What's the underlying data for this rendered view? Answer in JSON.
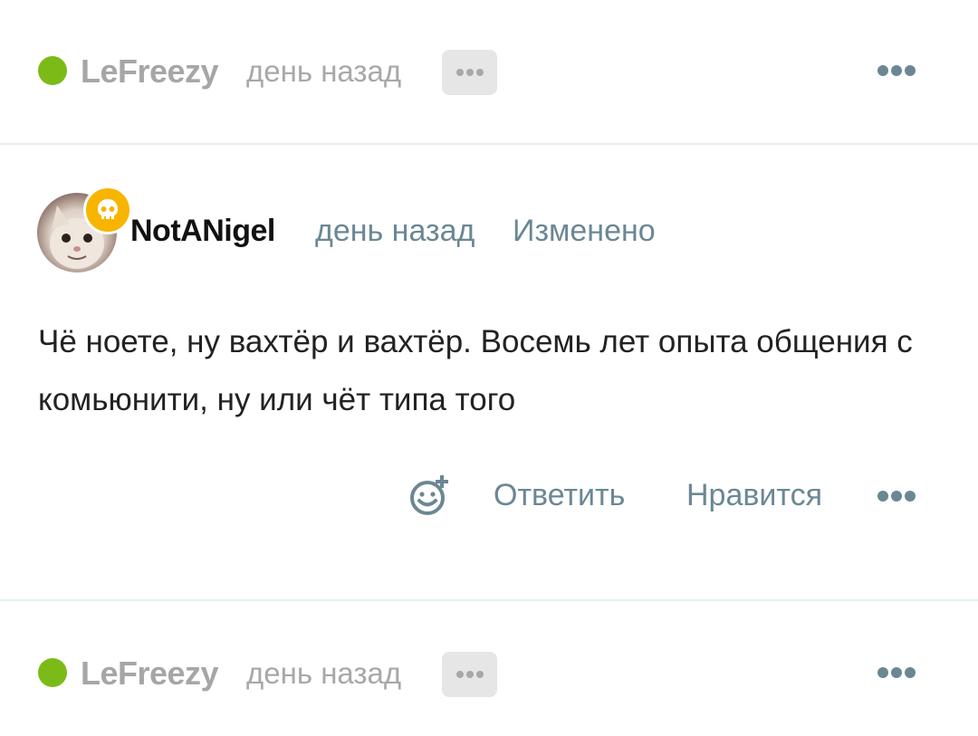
{
  "comments": [
    {
      "collapsed": true,
      "username": "LeFreezy",
      "time": "день назад",
      "status_color": "#7cbb17"
    },
    {
      "collapsed": false,
      "username": "NotANigel",
      "time": "день назад",
      "edited_label": "Изменено",
      "badge_icon": "skull-icon",
      "text": "Чё ноете, ну вахтёр и вахтёр. Восемь лет опыта общения с комьюнити, ну или чёт типа того",
      "actions": {
        "react_icon": "add-emoji-icon",
        "reply_label": "Ответить",
        "like_label": "Нравится",
        "more_icon": "more-dots-icon"
      }
    },
    {
      "collapsed": true,
      "username": "LeFreezy",
      "time": "день назад",
      "status_color": "#7cbb17"
    }
  ],
  "colors": {
    "accent": "#6b8794",
    "online": "#7cbb17",
    "badge": "#f7b500",
    "muted": "#a8a8a8"
  }
}
